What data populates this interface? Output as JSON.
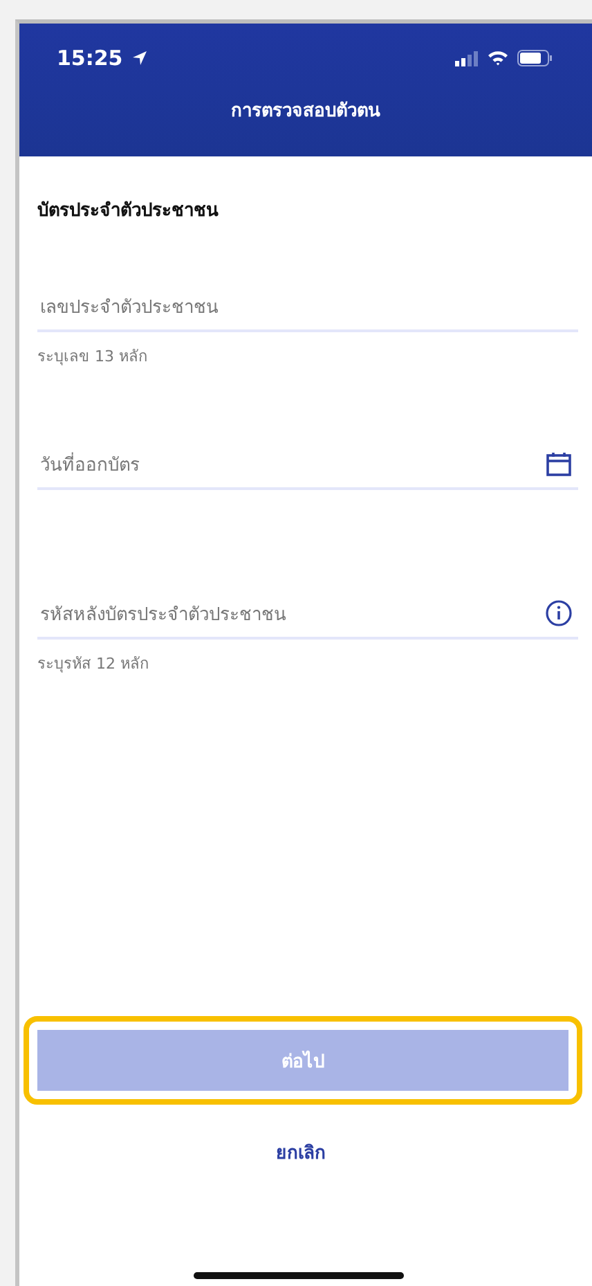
{
  "status_bar": {
    "time": "15:25"
  },
  "header": {
    "title": "การตรวจสอบตัวตน"
  },
  "section": {
    "title": "บัตรประจำตัวประชาชน"
  },
  "fields": [
    {
      "kind": "text",
      "placeholder": "เลขประจำตัวประชาชน",
      "hint": "ระบุเลข 13 หลัก"
    },
    {
      "kind": "date",
      "placeholder": "วันที่ออกบัตร"
    },
    {
      "kind": "info",
      "placeholder": "รหัสหลังบัตรประจำตัวประชาชน",
      "hint": "ระบุรหัส 12 หลัก"
    }
  ],
  "next_button": {
    "label": "ต่อไป",
    "disabled": true,
    "highlighted": true
  },
  "cancel_link": {
    "label": "ยกเลิก"
  }
}
